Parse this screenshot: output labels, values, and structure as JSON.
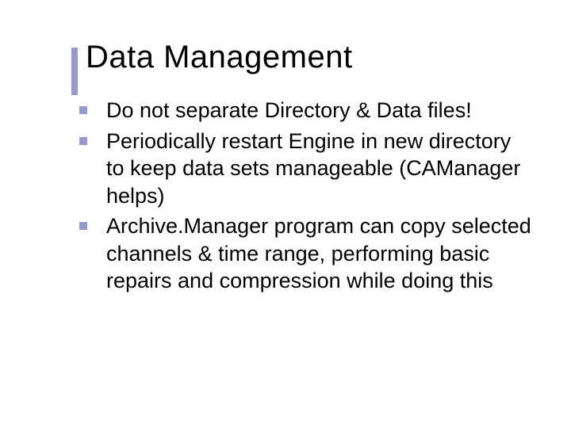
{
  "title": "Data Management",
  "bullets": [
    "Do not separate Directory & Data files!",
    "Periodically restart Engine in new directory to keep data sets manageable (CAManager helps)",
    "Archive.Manager program can copy selected channels & time range, performing basic repairs and compression while doing this"
  ]
}
